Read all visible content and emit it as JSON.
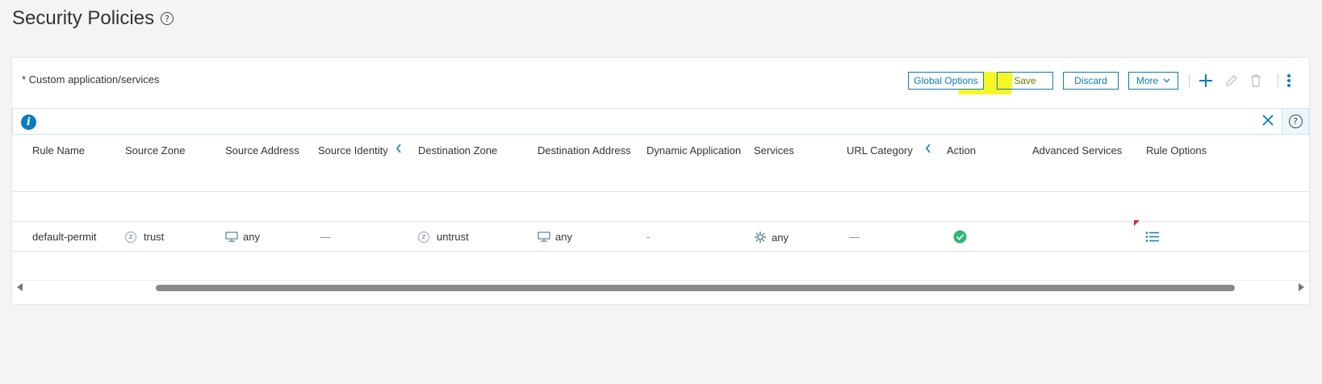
{
  "page": {
    "title": "Security Policies",
    "help_glyph": "?"
  },
  "panel": {
    "note": "* Custom application/services"
  },
  "toolbar": {
    "global_options_label": "Global Options",
    "save_label": "Save",
    "discard_label": "Discard",
    "more_label": "More",
    "icons": [
      "plus-icon",
      "pencil-icon",
      "trash-icon",
      "kebab-menu-icon"
    ],
    "accent_color": "#0b7bc2",
    "highlight_color": "#f5f500"
  },
  "infobar": {
    "info_glyph": "i",
    "help_glyph": "?"
  },
  "grid": {
    "columns": [
      "Rule Name",
      "Source Zone",
      "Source Address",
      "Source Identity",
      "Destination Zone",
      "Destination Address",
      "Dynamic Application",
      "Services",
      "URL Category",
      "Action",
      "Advanced Services",
      "Rule Options"
    ],
    "rows": [
      {
        "rule_name": "default-permit",
        "source_zone": "trust",
        "source_address": "any",
        "source_identity": "—",
        "destination_zone": "untrust",
        "destination_address": "any",
        "dynamic_application": "-",
        "services": "any",
        "url_category": "—",
        "action": "permit-check-icon",
        "rule_options": "list-icon"
      }
    ],
    "zone_glyph": "z",
    "action_color": "#2eb872"
  }
}
